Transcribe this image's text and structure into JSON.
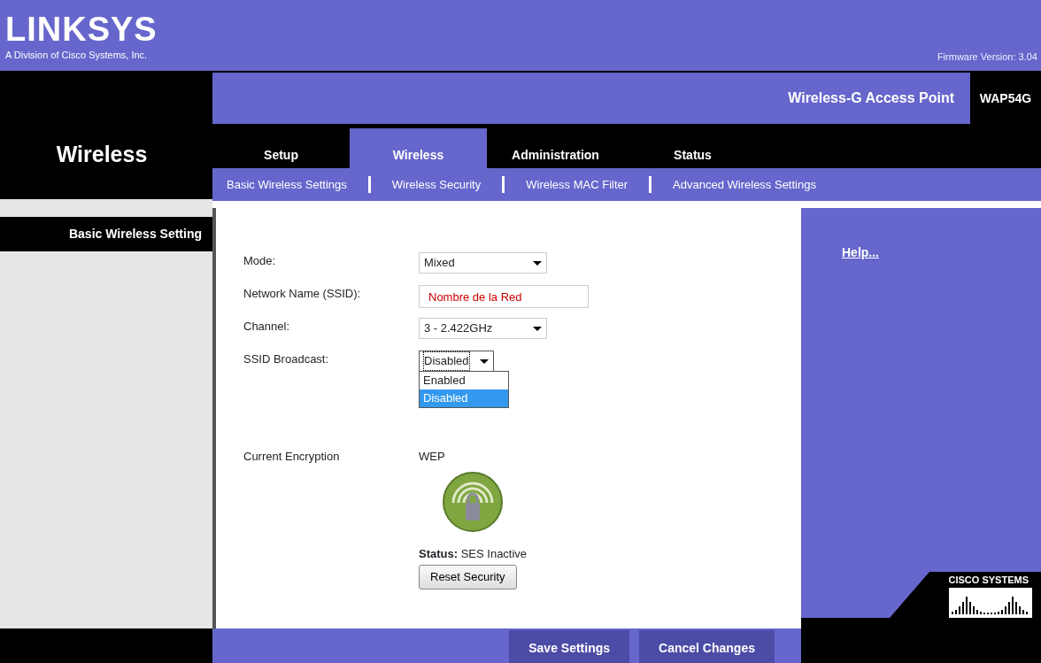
{
  "header": {
    "logo": "LINKSYS",
    "division": "A Division of Cisco Systems, Inc.",
    "firmware": "Firmware Version: 3.04"
  },
  "section_title": "Wireless",
  "product": {
    "name": "Wireless-G Access Point",
    "model": "WAP54G"
  },
  "tabs": [
    {
      "label": "Setup",
      "selected": false
    },
    {
      "label": "Wireless",
      "selected": true
    },
    {
      "label": "Administration",
      "selected": false
    },
    {
      "label": "Status",
      "selected": false
    }
  ],
  "subtabs": [
    "Basic Wireless Settings",
    "Wireless Security",
    "Wireless MAC Filter",
    "Advanced Wireless Settings"
  ],
  "sidebar": {
    "heading": "Basic Wireless Setting"
  },
  "form": {
    "fields": [
      {
        "kind": "select",
        "label": "Mode:",
        "value": "Mixed",
        "expanded": false
      },
      {
        "kind": "text",
        "label": "Network Name (SSID):",
        "value": "Nombre de la Red"
      },
      {
        "kind": "select",
        "label": "Channel:",
        "value": "3 - 2.422GHz",
        "expanded": false
      },
      {
        "kind": "select",
        "label": "SSID Broadcast:",
        "value": "Disabled",
        "expanded": true,
        "options": [
          {
            "label": "Enabled",
            "selected": false
          },
          {
            "label": "Disabled",
            "selected": true
          }
        ]
      }
    ],
    "encryption": {
      "label": "Current Encryption",
      "value": "WEP"
    },
    "ses_status": "**Status:** SES Inactive",
    "reset_button": "Reset Security"
  },
  "help": {
    "link": "Help..."
  },
  "brand": "CISCO SYSTEMS",
  "buttons": [
    "Save Settings",
    "Cancel Changes"
  ]
}
